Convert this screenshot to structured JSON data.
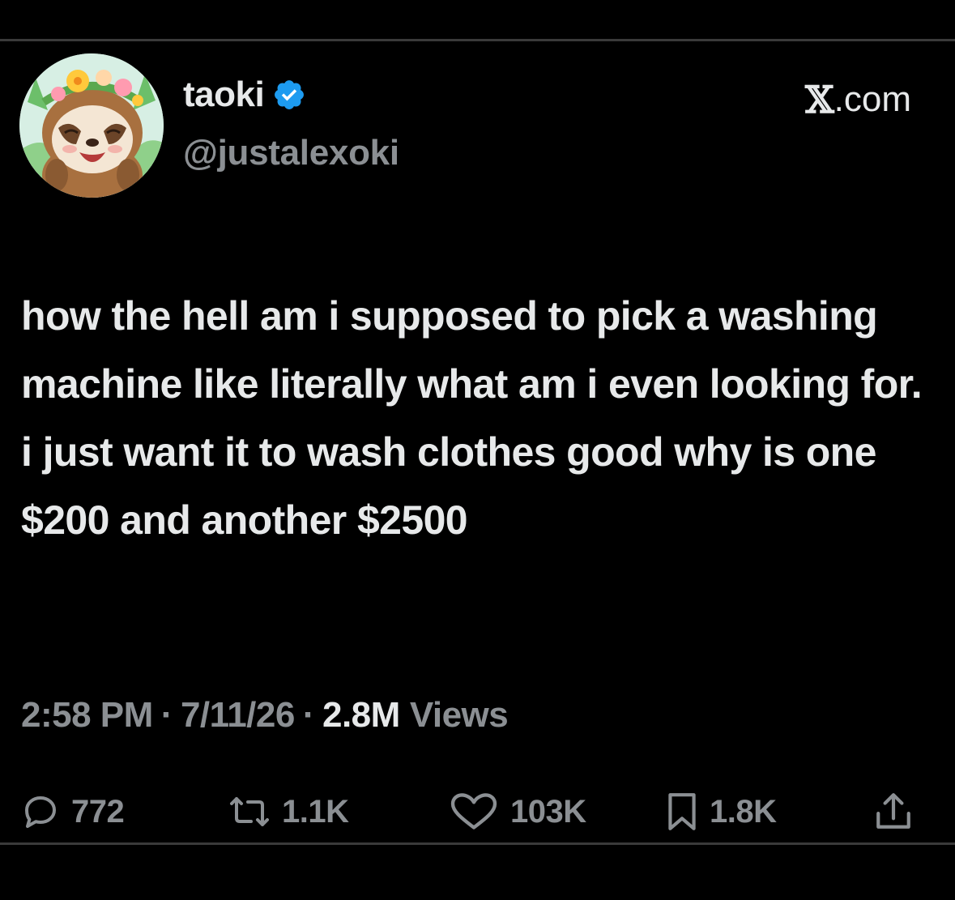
{
  "author": {
    "display_name": "taoki",
    "handle": "@justalexoki",
    "verified": true,
    "avatar_icon": "sloth-with-flower-crown-avatar"
  },
  "site": {
    "logo_glyph": "𝕏",
    "label": ".com"
  },
  "tweet": {
    "text": "how the hell am i supposed to pick a washing machine like literally what am i even looking for. i just want it to wash clothes good why is one $200 and another $2500",
    "time": "2:58 PM",
    "separator": "·",
    "date": "7/11/26",
    "views_count": "2.8M",
    "views_label": "Views"
  },
  "actions": {
    "replies": "772",
    "reposts": "1.1K",
    "likes": "103K",
    "bookmarks": "1.8K"
  },
  "colors": {
    "background": "#000000",
    "text_primary": "#e7e9ea",
    "text_secondary": "#8b8f93",
    "verified_blue": "#1d9bf0",
    "divider": "#3a3a3a"
  }
}
